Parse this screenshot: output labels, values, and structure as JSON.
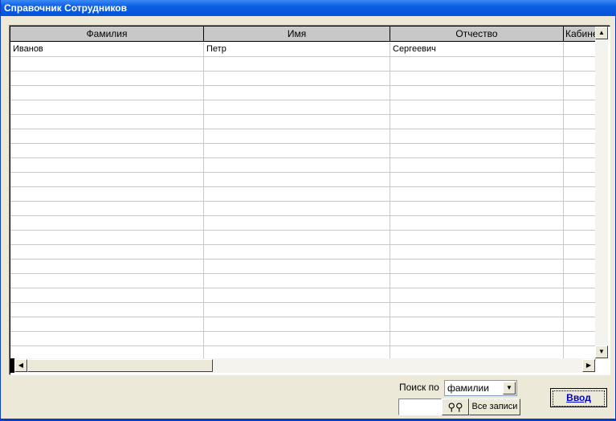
{
  "window": {
    "title": "Справочник Сотрудников"
  },
  "grid": {
    "columns": [
      "Фамилия",
      "Имя",
      "Отчество",
      "Кабинет"
    ],
    "rows": [
      [
        "Иванов",
        "Петр",
        "Сергеевич",
        ""
      ]
    ],
    "empty_rows": 21
  },
  "search": {
    "label": "Поиск по",
    "field_value": "фамилии",
    "text_value": "",
    "find_icon": "binoculars-icon",
    "all_records_label": "Все записи"
  },
  "enter_button": {
    "label": "Ввод"
  }
}
